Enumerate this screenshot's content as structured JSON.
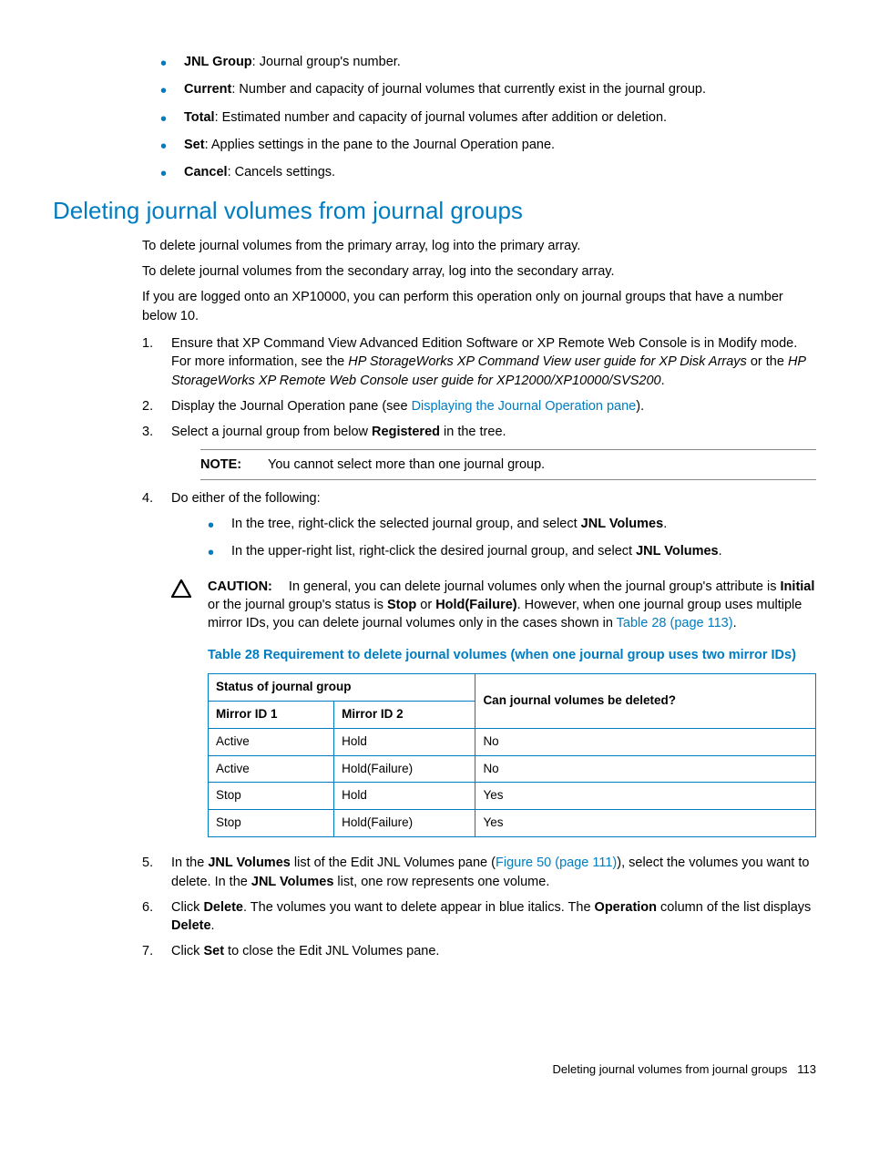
{
  "top_bullets": [
    {
      "term": "JNL Group",
      "desc": ": Journal group's number."
    },
    {
      "term": "Current",
      "desc": ": Number and capacity of journal volumes that currently exist in the journal group."
    },
    {
      "term": "Total",
      "desc": ": Estimated number and capacity of journal volumes after addition or deletion."
    },
    {
      "term": "Set",
      "desc": ": Applies settings in the pane to the Journal Operation pane."
    },
    {
      "term": "Cancel",
      "desc": ": Cancels settings."
    }
  ],
  "section_heading": "Deleting journal volumes from journal groups",
  "paras": {
    "p1": "To delete journal volumes from the primary array, log into the primary array.",
    "p2": "To delete journal volumes from the secondary array, log into the secondary array.",
    "p3": "If you are logged onto an XP10000, you can perform this operation only on journal groups that have a number below 10."
  },
  "step1": {
    "num": "1.",
    "t1": "Ensure that XP Command View Advanced Edition Software or XP Remote Web Console is in Modify mode. For more information, see the ",
    "i1": "HP StorageWorks XP Command View user guide for XP Disk Arrays",
    "t2": " or the ",
    "i2": "HP StorageWorks XP Remote Web Console user guide for XP12000/XP10000/SVS200",
    "t3": "."
  },
  "step2": {
    "num": "2.",
    "t1": "Display the Journal Operation pane (see ",
    "link": "Displaying the Journal Operation pane",
    "t2": ")."
  },
  "step3": {
    "num": "3.",
    "t1": "Select a journal group from below ",
    "b1": "Registered",
    "t2": " in the tree."
  },
  "note": {
    "label": "NOTE:",
    "text": "You cannot select more than one journal group."
  },
  "step4": {
    "num": "4.",
    "t1": "Do either of the following:",
    "sub1_a": "In the tree, right-click the selected journal group, and select ",
    "sub1_b": "JNL Volumes",
    "sub1_c": ".",
    "sub2_a": "In the upper-right list, right-click the desired journal group, and select ",
    "sub2_b": "JNL Volumes",
    "sub2_c": "."
  },
  "caution": {
    "label": "CAUTION:",
    "t1": "In general, you can delete journal volumes only when the journal group's attribute is ",
    "b1": "Initial",
    "t2": " or the journal group's status is ",
    "b2": "Stop",
    "t3": " or ",
    "b3": "Hold(Failure)",
    "t4": ". However, when one journal group uses multiple mirror IDs, you can delete journal volumes only in the cases shown in ",
    "link": "Table 28 (page 113)",
    "t5": "."
  },
  "table_caption": "Table 28 Requirement to delete journal volumes (when one journal group uses two mirror IDs)",
  "table": {
    "h1": "Status of journal group",
    "h2": "Can journal volumes be deleted?",
    "sh1": "Mirror ID 1",
    "sh2": "Mirror ID 2",
    "rows": [
      {
        "c1": "Active",
        "c2": "Hold",
        "c3": "No"
      },
      {
        "c1": "Active",
        "c2": "Hold(Failure)",
        "c3": "No"
      },
      {
        "c1": "Stop",
        "c2": "Hold",
        "c3": "Yes"
      },
      {
        "c1": "Stop",
        "c2": "Hold(Failure)",
        "c3": "Yes"
      }
    ]
  },
  "step5": {
    "num": "5.",
    "t1": "In the ",
    "b1": "JNL Volumes",
    "t2": " list of the Edit JNL Volumes pane (",
    "link": "Figure 50 (page 111)",
    "t3": "), select the volumes you want to delete. In the ",
    "b2": "JNL Volumes",
    "t4": " list, one row represents one volume."
  },
  "step6": {
    "num": "6.",
    "t1": "Click ",
    "b1": "Delete",
    "t2": ". The volumes you want to delete appear in blue italics. The ",
    "b2": "Operation",
    "t3": " column of the list displays ",
    "b3": "Delete",
    "t4": "."
  },
  "step7": {
    "num": "7.",
    "t1": "Click ",
    "b1": "Set",
    "t2": " to close the Edit JNL Volumes pane."
  },
  "footer": {
    "text": "Deleting journal volumes from journal groups",
    "page": "113"
  }
}
